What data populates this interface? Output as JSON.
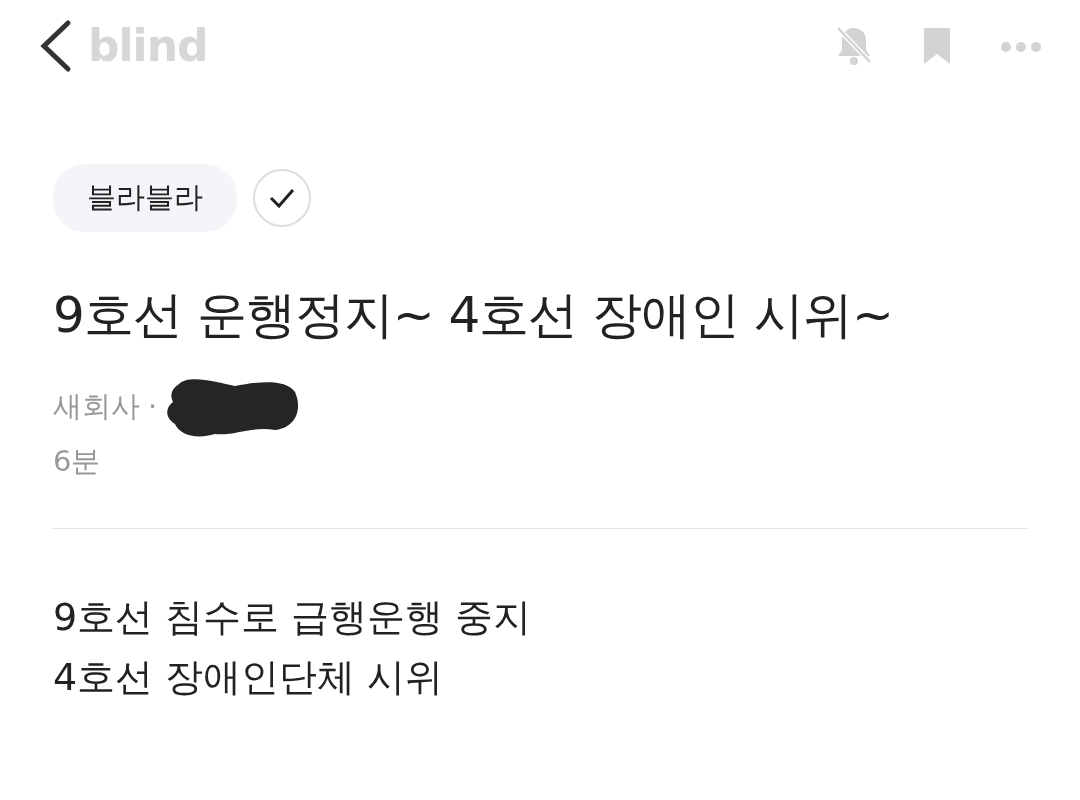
{
  "header": {
    "logo": "blind"
  },
  "topic_tag": {
    "label": "블라블라",
    "followed": true
  },
  "post": {
    "title": "9호선 운행정지~ 4호선 장애인 시위~",
    "company": "새회사",
    "separator": "·",
    "time": "6분",
    "body": [
      "9호선 침수로 급행운행 중지",
      "4호선 장애인단체 시위"
    ]
  }
}
